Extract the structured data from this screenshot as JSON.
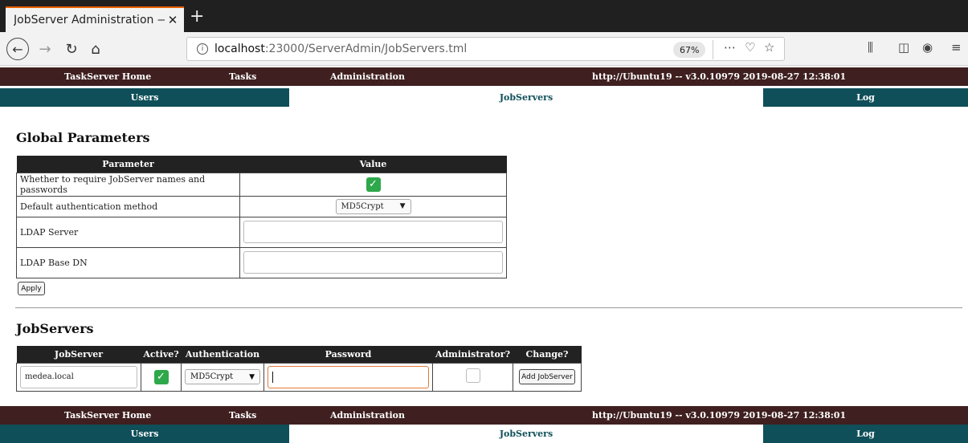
{
  "browser": {
    "tab_title": "JobServer Administration —",
    "url_host": "localhost",
    "url_rest": ":23000/ServerAdmin/JobServers.tml",
    "zoom": "67%"
  },
  "menu": {
    "home": "TaskServer Home",
    "tasks": "Tasks",
    "admin": "Administration",
    "server_info": "http://Ubuntu19 -- v3.0.10979  2019-08-27 12:38:01"
  },
  "submenu": {
    "users": "Users",
    "jobservers": "JobServers",
    "log": "Log"
  },
  "global": {
    "heading": "Global Parameters",
    "col_param": "Parameter",
    "col_value": "Value",
    "rows": [
      {
        "label": "Whether to require JobServer names and passwords",
        "checked": true
      },
      {
        "label": "Default authentication method",
        "value": "MD5Crypt"
      },
      {
        "label": "LDAP Server",
        "value": ""
      },
      {
        "label": "LDAP Base DN",
        "value": ""
      }
    ],
    "apply_label": "Apply"
  },
  "jobservers": {
    "heading": "JobServers",
    "cols": [
      "JobServer",
      "Active?",
      "Authentication",
      "Password",
      "Administrator?",
      "Change?"
    ],
    "new_row": {
      "name": "medea.local",
      "active": true,
      "auth": "MD5Crypt",
      "password": "",
      "admin": false,
      "button": "Add JobServer"
    }
  },
  "colors": {
    "menu_bg": "#3f1f1f",
    "submenu_bg": "#0f4f59",
    "check_green": "#2ea84a",
    "focus_orange": "#e07a3a"
  }
}
